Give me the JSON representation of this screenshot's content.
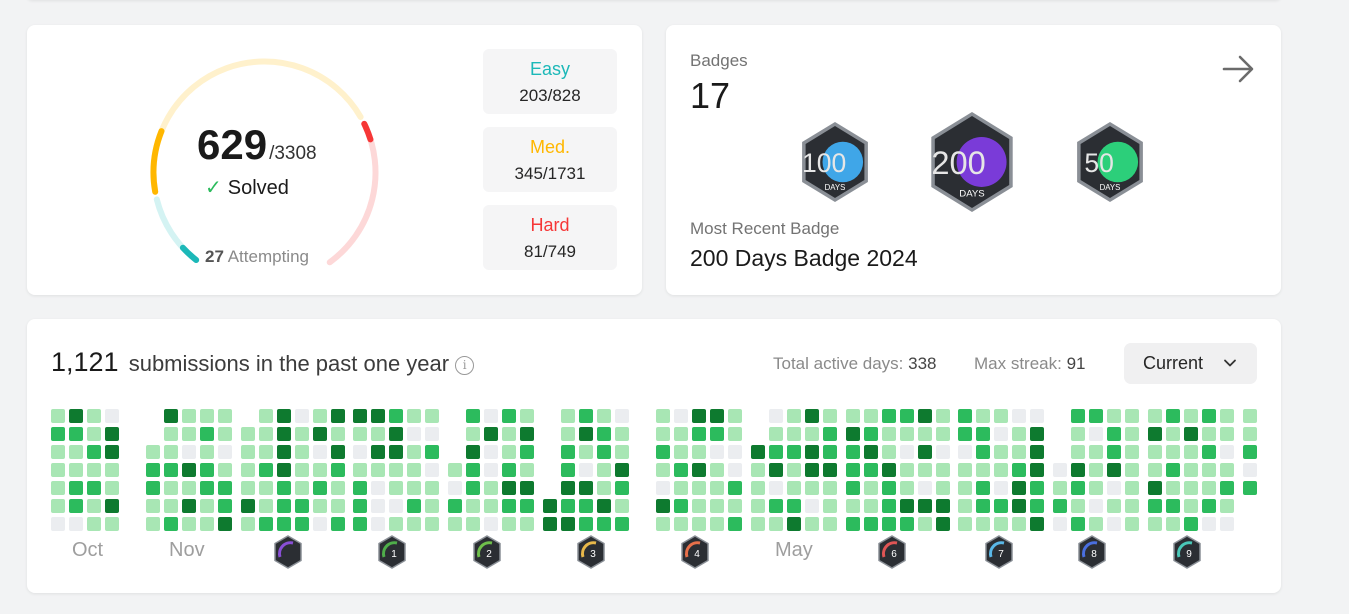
{
  "solved": {
    "count": "629",
    "total": "/3308",
    "label": "Solved",
    "attempting_count": "27",
    "attempting_label": "Attempting",
    "progress": {
      "easy": [
        203,
        828
      ],
      "medium": [
        345,
        1731
      ],
      "hard": [
        81,
        749
      ]
    }
  },
  "difficulty": {
    "easy": {
      "label": "Easy",
      "value": "203/828"
    },
    "medium": {
      "label": "Med.",
      "value": "345/1731"
    },
    "hard": {
      "label": "Hard",
      "value": "81/749"
    }
  },
  "badges": {
    "title": "Badges",
    "count": "17",
    "recent_label": "Most Recent Badge",
    "recent_name": "200 Days Badge 2024",
    "items": [
      {
        "icon": "100-days-badge-icon",
        "number": "100",
        "text": "DAYS",
        "fill": "#3fa6e8"
      },
      {
        "icon": "200-days-badge-icon",
        "number": "200",
        "text": "DAYS",
        "fill": "#7a3bd8"
      },
      {
        "icon": "50-days-badge-icon",
        "number": "50",
        "text": "DAYS",
        "fill": "#2ccf7a"
      }
    ]
  },
  "submissions": {
    "count": "1,121",
    "label": "submissions in the past one year",
    "active_label": "Total active days:",
    "active_value": "338",
    "streak_label": "Max streak:",
    "streak_value": "91",
    "period": "Current",
    "months": [
      {
        "type": "text",
        "label": "Oct"
      },
      {
        "type": "text",
        "label": "Nov"
      },
      {
        "type": "icon",
        "icon": "december-badge-icon",
        "label": "",
        "color": "#8a4fd6"
      },
      {
        "type": "icon",
        "icon": "january-badge-icon",
        "label": "1",
        "color": "#4fae4a"
      },
      {
        "type": "icon",
        "icon": "february-badge-icon",
        "label": "2",
        "color": "#6fbf4b"
      },
      {
        "type": "icon",
        "icon": "march-badge-icon",
        "label": "3",
        "color": "#e8b84a"
      },
      {
        "type": "icon",
        "icon": "april-badge-icon",
        "label": "4",
        "color": "#e8704a"
      },
      {
        "type": "text",
        "label": "May"
      },
      {
        "type": "icon",
        "icon": "june-badge-icon",
        "label": "6",
        "color": "#e05555"
      },
      {
        "type": "icon",
        "icon": "july-badge-icon",
        "label": "7",
        "color": "#5ab8e8"
      },
      {
        "type": "icon",
        "icon": "august-badge-icon",
        "label": "8",
        "color": "#4a6fe0"
      },
      {
        "type": "icon",
        "icon": "september-badge-icon",
        "label": "9",
        "color": "#4ac8b8"
      }
    ]
  },
  "colors": {
    "easy": "#1cb8b8",
    "medium": "#ffb700",
    "hard": "#f63737",
    "heat": [
      "#ebedf0",
      "#a8e6b4",
      "#2cbb5d",
      "#0e7a2f"
    ]
  }
}
